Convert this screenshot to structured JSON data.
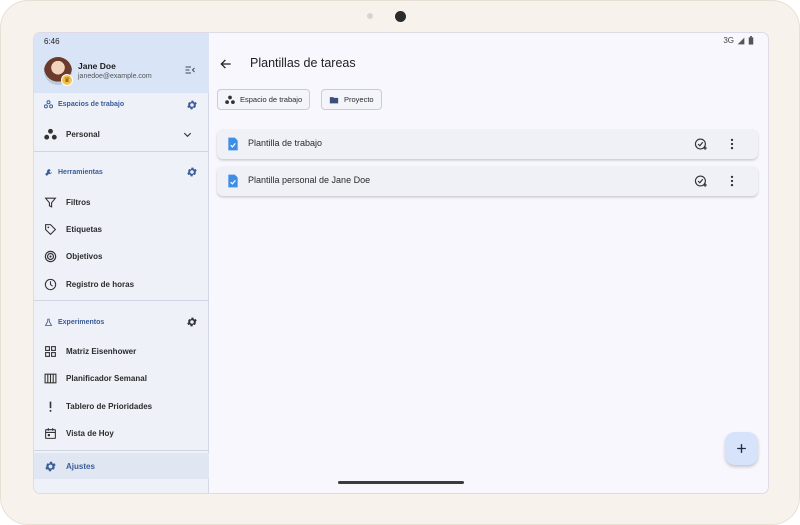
{
  "status_bar": {
    "time": "6:46",
    "network": "3G"
  },
  "user": {
    "name": "Jane Doe",
    "email": "janedoe@example.com"
  },
  "sidebar": {
    "workspaces_title": "Espacios de trabajo",
    "workspace_selected": "Personal",
    "tools_title": "Herramientas",
    "tools": [
      {
        "label": "Filtros",
        "icon": "filter-icon"
      },
      {
        "label": "Etiquetas",
        "icon": "tag-icon"
      },
      {
        "label": "Objetivos",
        "icon": "target-icon"
      },
      {
        "label": "Registro de horas",
        "icon": "clock-icon"
      }
    ],
    "experiments_title": "Experimentos",
    "experiments": [
      {
        "label": "Matriz Eisenhower",
        "icon": "grid-icon"
      },
      {
        "label": "Planificador Semanal",
        "icon": "columns-icon"
      },
      {
        "label": "Tablero de Prioridades",
        "icon": "exclamation-icon"
      },
      {
        "label": "Vista de Hoy",
        "icon": "calendar-icon"
      }
    ],
    "settings_label": "Ajustes"
  },
  "main": {
    "title": "Plantillas de tareas",
    "chips": [
      {
        "label": "Espacio de trabajo",
        "icon": "workspace-icon"
      },
      {
        "label": "Proyecto",
        "icon": "folder-icon"
      }
    ],
    "templates": [
      {
        "title": "Plantilla de trabajo"
      },
      {
        "title": "Plantilla personal de Jane Doe"
      }
    ]
  },
  "colors": {
    "accent": "#2f6fd1",
    "sidebar_header": "#d9e4f7",
    "fab": "#d6e3fb"
  }
}
